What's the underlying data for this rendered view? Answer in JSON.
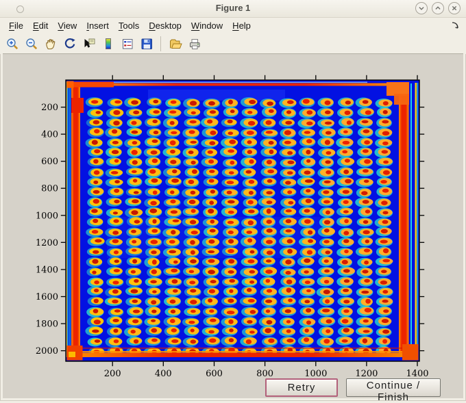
{
  "window": {
    "title": "Figure 1",
    "controls": [
      {
        "name": "minimize",
        "glyph": "chevron-down"
      },
      {
        "name": "maximize",
        "glyph": "chevron-up"
      },
      {
        "name": "close",
        "glyph": "x"
      }
    ]
  },
  "menu_bar": {
    "items": [
      {
        "label": "File",
        "mnemonic_index": 0
      },
      {
        "label": "Edit",
        "mnemonic_index": 0
      },
      {
        "label": "View",
        "mnemonic_index": 0
      },
      {
        "label": "Insert",
        "mnemonic_index": 0
      },
      {
        "label": "Tools",
        "mnemonic_index": 0
      },
      {
        "label": "Desktop",
        "mnemonic_index": 0
      },
      {
        "label": "Window",
        "mnemonic_index": 0
      },
      {
        "label": "Help",
        "mnemonic_index": 0
      }
    ],
    "dock_icon": "dock-arrow"
  },
  "toolbar": {
    "icons": [
      "zoom-in",
      "zoom-out",
      "pan",
      "rotate-3d",
      "data-cursor",
      "insert-colorbar",
      "insert-legend",
      "save-figure",
      "separator",
      "open-file",
      "print-figure"
    ]
  },
  "buttons": {
    "retry": "Retry",
    "continue_finish": "Continue / Finish"
  },
  "chart_data": {
    "type": "heatmap",
    "title": "",
    "description": "imagesc-style scan of a microplate/microarray: regular grid of red-centered yellow spots with cyan halos on deep blue background, saturated red bands along all four image edges (jet colormap)",
    "x_ticks": [
      200,
      400,
      600,
      800,
      1000,
      1200,
      1400
    ],
    "y_ticks": [
      200,
      400,
      600,
      800,
      1000,
      1200,
      1400,
      1600,
      1800,
      2000
    ],
    "x_range": [
      16,
      1408
    ],
    "y_range": [
      0,
      2078
    ],
    "grid": {
      "cols": 16,
      "rows": 26,
      "x_start": 137,
      "x_step": 75.8,
      "y_start": 165,
      "y_step": 73.5
    },
    "colors": {
      "background": "#0311e2",
      "halo": "#2bd9cc",
      "body": "#ffc608",
      "body_warm": "#ffa43a",
      "center": "#ee2400",
      "center_dark": "#b81400",
      "edge_red": "#ec2400",
      "edge_orange": "#ff9000",
      "edge_yellow": "#ffd800",
      "stripe_cyan": "#20d0e8",
      "axis": "#000000"
    },
    "legend": "none",
    "grid_lines": "off"
  }
}
